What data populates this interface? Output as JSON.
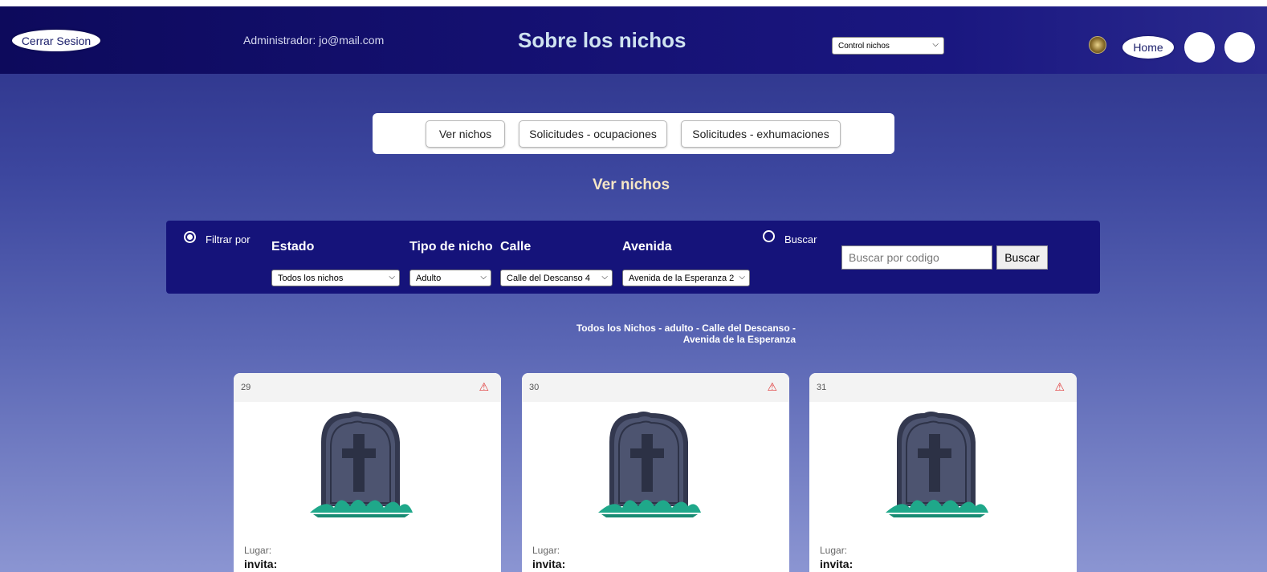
{
  "header": {
    "logout_label": "Cerrar Sesion",
    "admin_text": "Administrador: jo@mail.com",
    "title": "Sobre los nichos",
    "nav_select_value": "Control nichos",
    "home_label": "Home"
  },
  "tabs": {
    "ver_nichos": "Ver nichos",
    "ocupaciones": "Solicitudes - ocupaciones",
    "exhumaciones": "Solicitudes - exhumaciones"
  },
  "section_title": "Ver nichos",
  "filters": {
    "filtrar_label": "Filtrar por",
    "buscar_label": "Buscar",
    "estado_label": "Estado",
    "tipo_label": "Tipo de nicho",
    "calle_label": "Calle",
    "avenida_label": "Avenida",
    "estado_value": "Todos los nichos",
    "tipo_value": "Adulto",
    "calle_value": "Calle del Descanso 4",
    "avenida_value": "Avenida de la Esperanza 2",
    "search_placeholder": "Buscar por codigo",
    "search_button": "Buscar"
  },
  "result_caption_line1": "Todos los Nichos - adulto - Calle del Descanso -",
  "result_caption_line2": "Avenida de la Esperanza",
  "cards": [
    {
      "number": "29",
      "lugar_label": "Lugar:",
      "invita_label": "invita:"
    },
    {
      "number": "30",
      "lugar_label": "Lugar:",
      "invita_label": "invita:"
    },
    {
      "number": "31",
      "lugar_label": "Lugar:",
      "invita_label": "invita:"
    }
  ],
  "colors": {
    "header_bg": "#151173",
    "panel_bg": "#15137a",
    "title_color": "#cfe3f0",
    "section_title_color": "#f5e6c6",
    "warning_color": "#e03a3a",
    "tombstone": "#4a5068",
    "grass": "#1fa88a"
  },
  "icons": {
    "warning": "warning-triangle-icon",
    "tombstone": "tombstone-icon",
    "seal": "seal-logo-icon",
    "chevron": "chevron-down-icon"
  }
}
